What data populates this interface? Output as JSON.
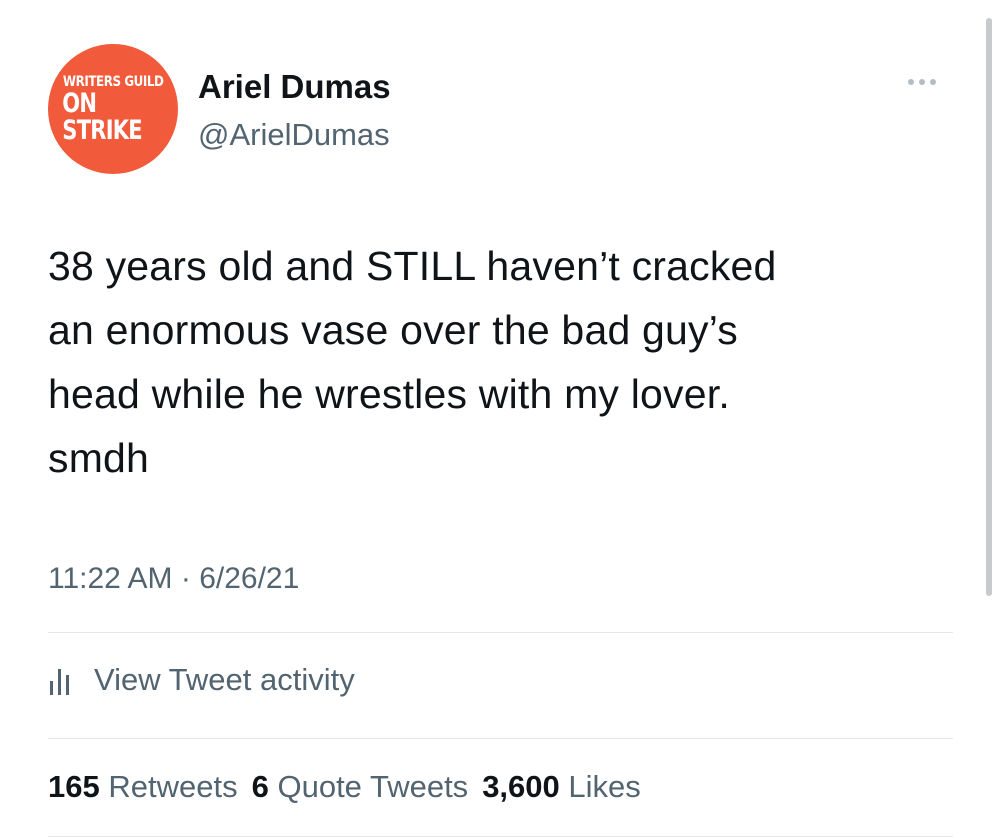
{
  "author": {
    "avatar_line1": "WRITERS GUILD",
    "avatar_line2": "ON STRIKE",
    "avatar_color": "#f15a3a",
    "name": "Ariel Dumas",
    "handle": "@ArielDumas"
  },
  "tweet": {
    "text": "38 years old and STILL haven’t cracked\nan enormous vase over the bad guy’s\nhead while he wrestles with my lover.\nsmdh",
    "time": "11:22 AM",
    "date": "6/26/21"
  },
  "activity": {
    "label": "View Tweet activity",
    "icon": "bar-chart-icon"
  },
  "stats": {
    "retweets_count": "165",
    "retweets_label": "Retweets",
    "quotes_count": "6",
    "quotes_label": "Quote Tweets",
    "likes_count": "3,600",
    "likes_label": "Likes"
  },
  "more_icon": "more-horizontal-icon"
}
